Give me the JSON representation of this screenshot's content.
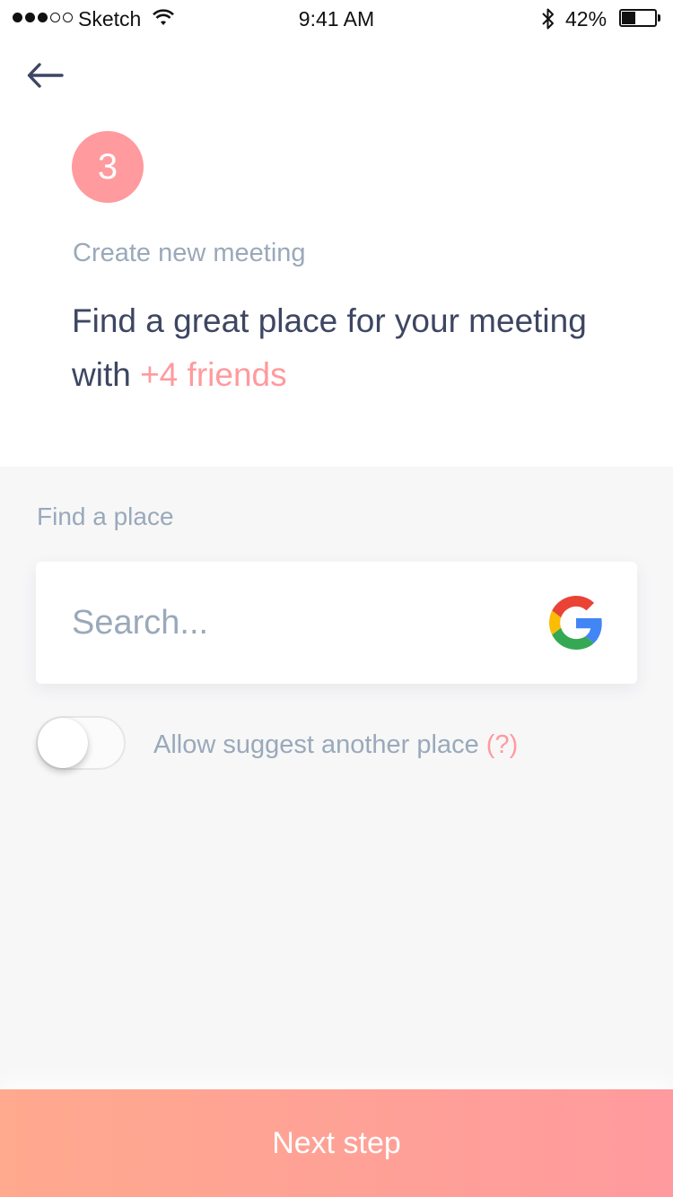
{
  "status_bar": {
    "carrier": "Sketch",
    "time": "9:41 AM",
    "battery_percent": "42%",
    "battery_level": 0.42,
    "signal_bars_filled": 3,
    "signal_bars_total": 5
  },
  "header": {
    "back_icon": "arrow-left-icon",
    "step_number": "3",
    "subtitle": "Create new meeting",
    "headline_text": "Find a great place for your meeting with ",
    "headline_accent": "+4 friends"
  },
  "place": {
    "label": "Find a place",
    "search_placeholder": "Search...",
    "search_value": "",
    "provider_icon": "google-icon"
  },
  "suggest": {
    "label": "Allow suggest another place",
    "help": "(?)",
    "enabled": false
  },
  "footer": {
    "next_label": "Next step"
  },
  "colors": {
    "accent": "#ff9a9e",
    "gradient_start": "#ffa98e",
    "text_primary": "#3d4662",
    "text_secondary": "#9aa9ba",
    "section_bg": "#f7f7f8"
  }
}
